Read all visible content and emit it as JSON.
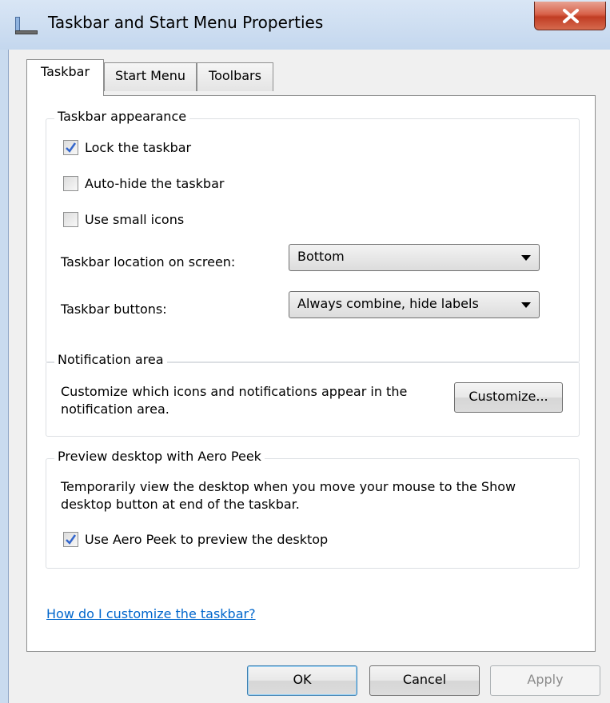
{
  "window": {
    "title": "Taskbar and Start Menu Properties",
    "title_icon": "taskbar-icon",
    "close_icon": "close-icon"
  },
  "tabs": [
    {
      "label": "Taskbar",
      "active": true
    },
    {
      "label": "Start Menu",
      "active": false
    },
    {
      "label": "Toolbars",
      "active": false
    }
  ],
  "appearance": {
    "title": "Taskbar appearance",
    "lock_label": "Lock the taskbar",
    "lock_checked": true,
    "autohide_label": "Auto-hide the taskbar",
    "autohide_checked": false,
    "small_icons_label": "Use small icons",
    "small_icons_checked": false,
    "location_label": "Taskbar location on screen:",
    "location_value": "Bottom",
    "buttons_label": "Taskbar buttons:",
    "buttons_value": "Always combine, hide labels"
  },
  "notification": {
    "title": "Notification area",
    "description": "Customize which icons and notifications appear in the notification area.",
    "customize_label": "Customize..."
  },
  "peek": {
    "title": "Preview desktop with Aero Peek",
    "description": "Temporarily view the desktop when you move your mouse to the Show desktop button at end of the taskbar.",
    "use_label": "Use Aero Peek to preview the desktop",
    "use_checked": true
  },
  "help_link": "How do I customize the taskbar?",
  "buttons": {
    "ok": "OK",
    "cancel": "Cancel",
    "apply": "Apply"
  },
  "colors": {
    "link": "#0066cc",
    "check": "#3366cc"
  }
}
